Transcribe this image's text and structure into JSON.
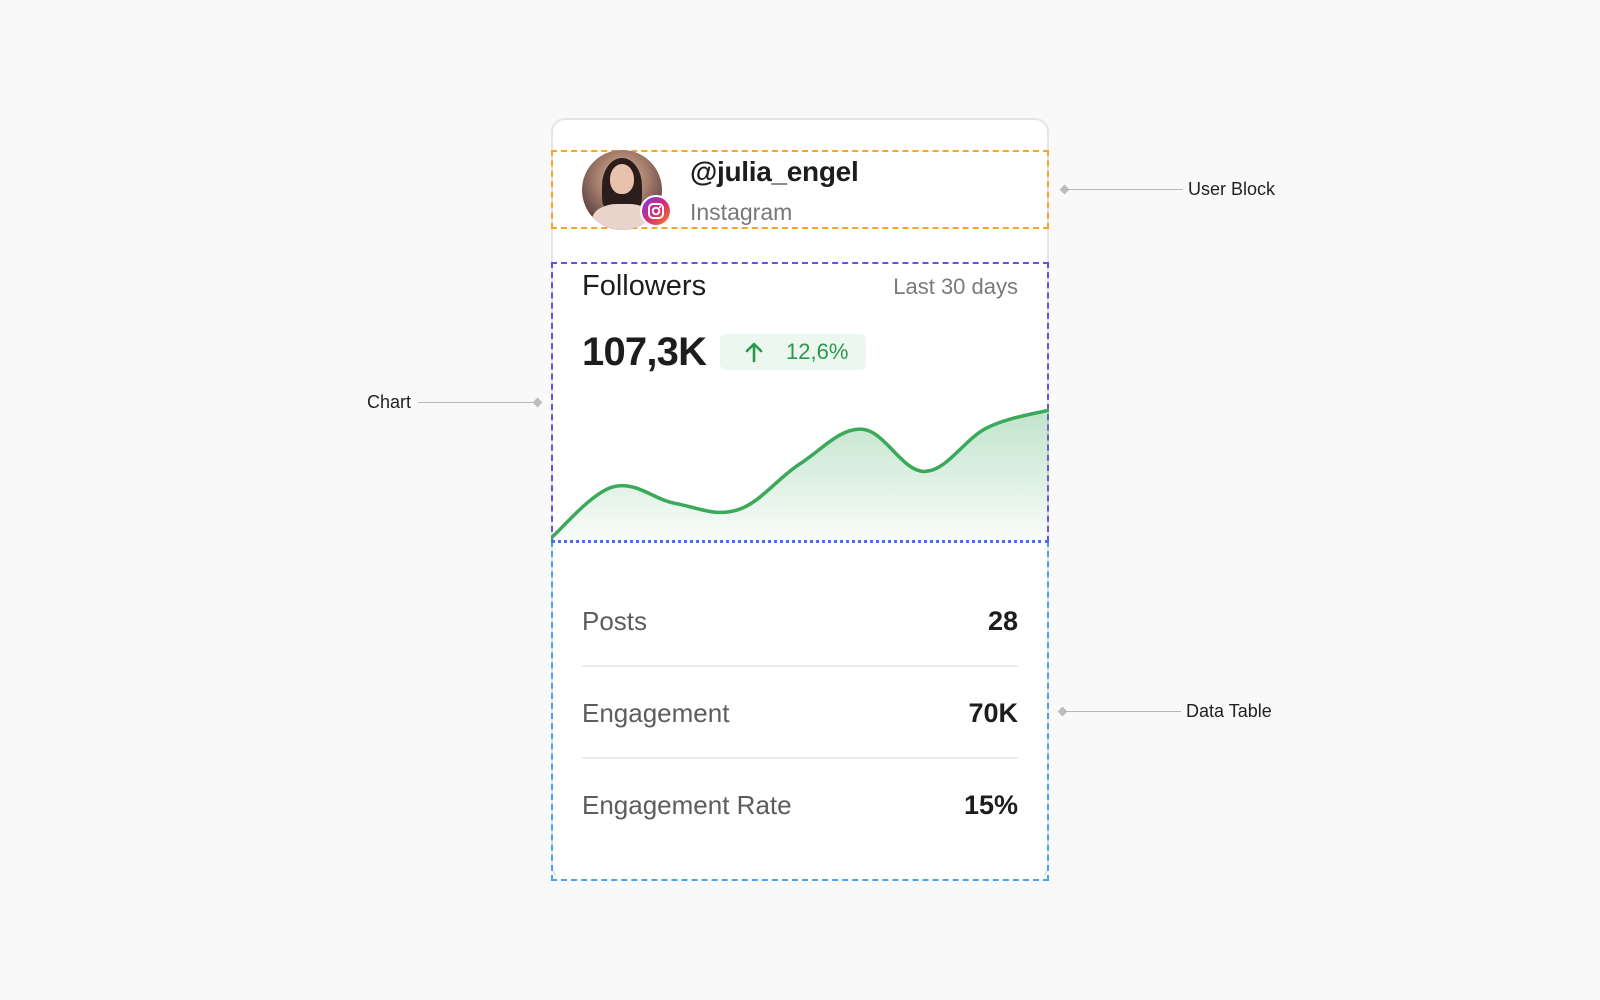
{
  "user": {
    "username": "@julia_engel",
    "platform": "Instagram",
    "platform_icon": "instagram-icon"
  },
  "followers": {
    "title": "Followers",
    "period": "Last 30 days",
    "value": "107,3K",
    "delta": "12,6%",
    "delta_direction": "up",
    "delta_color": "#2a9a4a"
  },
  "chart_data": {
    "type": "area",
    "title": "",
    "xlabel": "",
    "ylabel": "",
    "x": [
      0,
      1,
      2,
      3,
      4,
      5,
      6,
      7,
      8
    ],
    "series": [
      {
        "values": [
          0,
          40,
          27,
          22,
          58,
          85,
          52,
          86,
          100
        ]
      }
    ],
    "ylim": [
      0,
      100
    ],
    "grid": false,
    "color": "#3aaa5a"
  },
  "table": {
    "rows": [
      {
        "label": "Posts",
        "value": "28"
      },
      {
        "label": "Engagement",
        "value": "70K"
      },
      {
        "label": "Engagement Rate",
        "value": "15%"
      }
    ]
  },
  "callouts": {
    "user_block": "User Block",
    "chart": "Chart",
    "data_table": "Data Table"
  }
}
